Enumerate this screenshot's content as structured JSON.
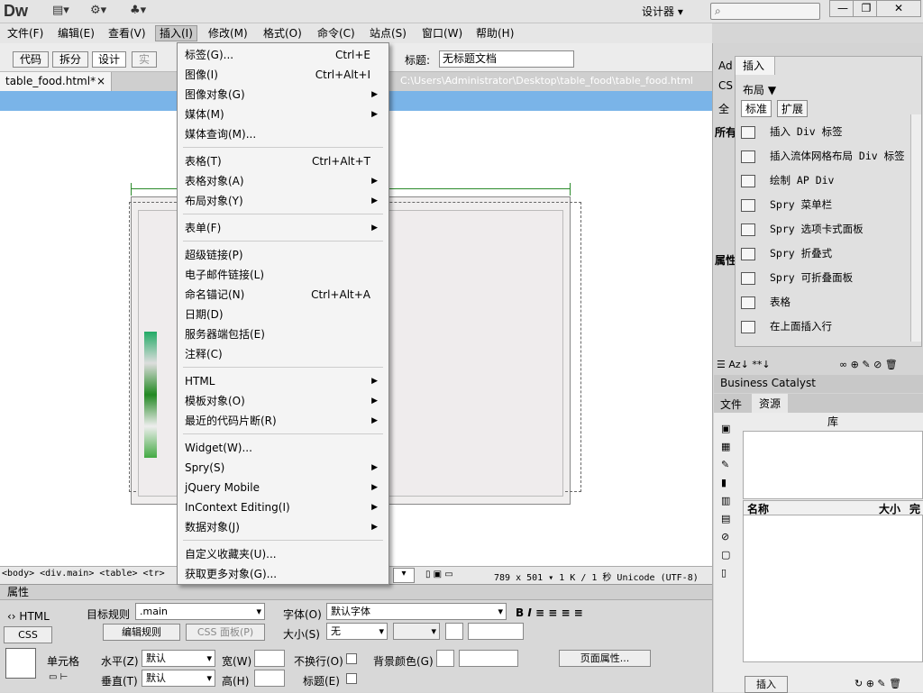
{
  "app": {
    "logo": "Dw",
    "workspace": "设计器",
    "search_icon": "⌕"
  },
  "window": {
    "min": "—",
    "restore": "❐",
    "close": "✕"
  },
  "menubar": [
    "文件(F)",
    "编辑(E)",
    "查看(V)",
    "插入(I)",
    "修改(M)",
    "格式(O)",
    "命令(C)",
    "站点(S)",
    "窗口(W)",
    "帮助(H)"
  ],
  "viewbar": {
    "code": "代码",
    "split": "拆分",
    "design": "设计",
    "live": "实",
    "title_label": "标题:",
    "title_value": "无标题文档"
  },
  "doc": {
    "tab": "table_food.html*",
    "close": "×",
    "path": "C:\\Users\\Administrator\\Desktop\\table_food\\table_food.html"
  },
  "status": {
    "tagpath": "<body> <div.main> <table> <tr>",
    "zoom": "▾",
    "dims": "789 x 501 ▾ 1 K / 1 秒 Unicode (UTF-8)"
  },
  "insert_menu": {
    "groups": [
      [
        {
          "label": "标签(G)...",
          "shortcut": "Ctrl+E"
        },
        {
          "label": "图像(I)",
          "shortcut": "Ctrl+Alt+I"
        },
        {
          "label": "图像对象(G)",
          "sub": true
        },
        {
          "label": "媒体(M)",
          "sub": true
        },
        {
          "label": "媒体查询(M)..."
        }
      ],
      [
        {
          "label": "表格(T)",
          "shortcut": "Ctrl+Alt+T"
        },
        {
          "label": "表格对象(A)",
          "sub": true
        },
        {
          "label": "布局对象(Y)",
          "sub": true
        }
      ],
      [
        {
          "label": "表单(F)",
          "sub": true
        }
      ],
      [
        {
          "label": "超级链接(P)"
        },
        {
          "label": "电子邮件链接(L)"
        },
        {
          "label": "命名锚记(N)",
          "shortcut": "Ctrl+Alt+A"
        },
        {
          "label": "日期(D)"
        },
        {
          "label": "服务器端包括(E)"
        },
        {
          "label": "注释(C)"
        }
      ],
      [
        {
          "label": "HTML",
          "sub": true
        },
        {
          "label": "模板对象(O)",
          "sub": true
        },
        {
          "label": "最近的代码片断(R)",
          "sub": true
        }
      ],
      [
        {
          "label": "Widget(W)..."
        },
        {
          "label": "Spry(S)",
          "sub": true
        },
        {
          "label": "jQuery Mobile",
          "sub": true
        },
        {
          "label": "InContext Editing(I)",
          "sub": true
        },
        {
          "label": "数据对象(J)",
          "sub": true
        }
      ],
      [
        {
          "label": "自定义收藏夹(U)..."
        },
        {
          "label": "获取更多对象(G)..."
        }
      ]
    ]
  },
  "props": {
    "header": "属性",
    "html": "HTML",
    "css": "CSS",
    "target_rule_label": "目标规则",
    "target_rule": ".main",
    "edit_rule": "编辑规则",
    "css_panel": "CSS 面板(P)",
    "font_label": "字体(O)",
    "font_value": "默认字体",
    "size_label": "大小(S)",
    "size_value": "无",
    "cell_label": "单元格",
    "horiz_label": "水平(Z)",
    "horiz_value": "默认",
    "vert_label": "垂直(T)",
    "vert_value": "默认",
    "width_label": "宽(W)",
    "height_label": "高(H)",
    "nowrap_label": "不换行(O)",
    "header_label": "标题(E)",
    "bg_label": "背景颜色(G)",
    "page_props": "页面属性..."
  },
  "right": {
    "side_tabs": [
      "Ad",
      "CS",
      "全",
      "所有",
      "属性"
    ],
    "insert_tab": "插入",
    "category": "布局",
    "std": "标准",
    "ext": "扩展",
    "items": [
      "插入 Div 标签",
      "插入流体网格布局 Div 标签",
      "绘制 AP Div",
      "Spry 菜单栏",
      "Spry 选项卡式面板",
      "Spry 折叠式",
      "Spry 可折叠面板",
      "表格",
      "在上面插入行"
    ],
    "bc": "Business Catalyst",
    "files": "文件",
    "assets": "资源",
    "library": "库",
    "col_name": "名称",
    "col_size": "大小",
    "col_done": "完",
    "insert_btn": "插入"
  }
}
